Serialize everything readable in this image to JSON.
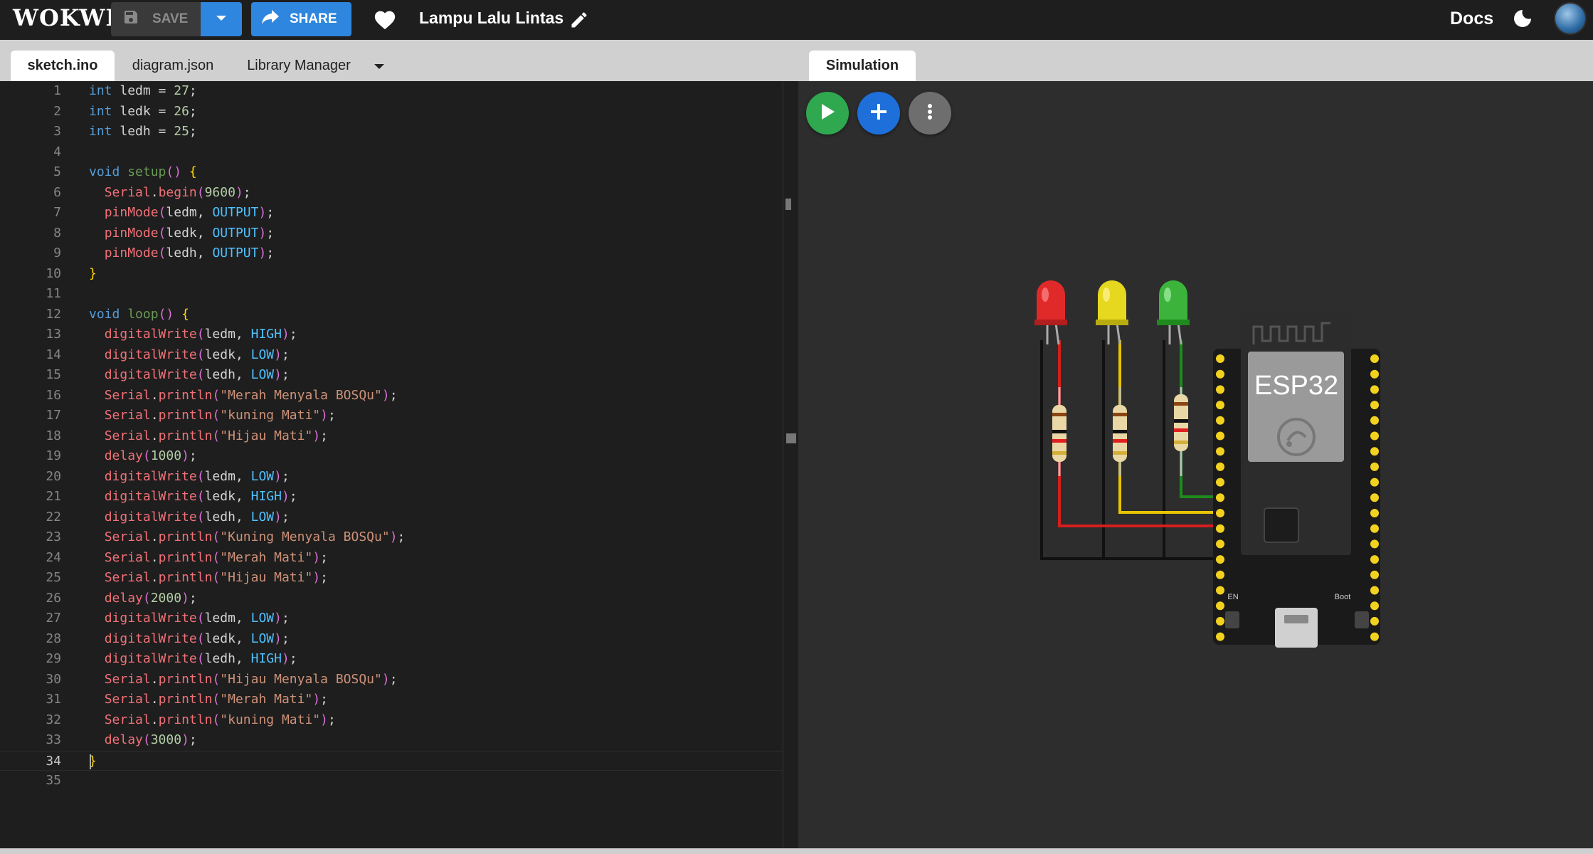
{
  "app": {
    "logo_text": "WOKWI"
  },
  "toolbar": {
    "save_label": "SAVE",
    "share_label": "SHARE",
    "project_title": "Lampu Lalu Lintas",
    "docs_label": "Docs"
  },
  "editor_tabs": [
    {
      "label": "sketch.ino",
      "active": true
    },
    {
      "label": "diagram.json",
      "active": false
    },
    {
      "label": "Library Manager",
      "active": false
    }
  ],
  "sim_tab": {
    "label": "Simulation"
  },
  "code_lines": [
    "int ledm = 27;",
    "int ledk = 26;",
    "int ledh = 25;",
    "",
    "void setup() {",
    "  Serial.begin(9600);",
    "  pinMode(ledm, OUTPUT);",
    "  pinMode(ledk, OUTPUT);",
    "  pinMode(ledh, OUTPUT);",
    "}",
    "",
    "void loop() {",
    "  digitalWrite(ledm, HIGH);",
    "  digitalWrite(ledk, LOW);",
    "  digitalWrite(ledh, LOW);",
    "  Serial.println(\"Merah Menyala BOSQu\");",
    "  Serial.println(\"kuning Mati\");",
    "  Serial.println(\"Hijau Mati\");",
    "  delay(1000);",
    "  digitalWrite(ledm, LOW);",
    "  digitalWrite(ledk, HIGH);",
    "  digitalWrite(ledh, LOW);",
    "  Serial.println(\"Kuning Menyala BOSQu\");",
    "  Serial.println(\"Merah Mati\");",
    "  Serial.println(\"Hijau Mati\");",
    "  delay(2000);",
    "  digitalWrite(ledm, LOW);",
    "  digitalWrite(ledk, LOW);",
    "  digitalWrite(ledh, HIGH);",
    "  Serial.println(\"Hijau Menyala BOSQu\");",
    "  Serial.println(\"Merah Mati\");",
    "  Serial.println(\"kuning Mati\");",
    "  delay(3000);",
    "}",
    ""
  ],
  "current_line": 34,
  "circuit": {
    "board_label": "ESP32",
    "leds": [
      {
        "color": "red",
        "hex": "#e02a2a"
      },
      {
        "color": "yellow",
        "hex": "#e6d81e"
      },
      {
        "color": "green",
        "hex": "#3cb43c"
      }
    ],
    "board_small_labels": {
      "en": "EN",
      "boot": "Boot"
    }
  },
  "colors": {
    "accent": "#2e86de",
    "play": "#2fa84f",
    "add": "#1e6fd9",
    "more": "#6e6e6e"
  },
  "icons": [
    "save-icon",
    "chevron-down-icon",
    "share-arrow-icon",
    "heart-icon",
    "pencil-icon",
    "moon-icon",
    "play-icon",
    "plus-icon",
    "more-vert-icon",
    "caret-down-icon"
  ]
}
